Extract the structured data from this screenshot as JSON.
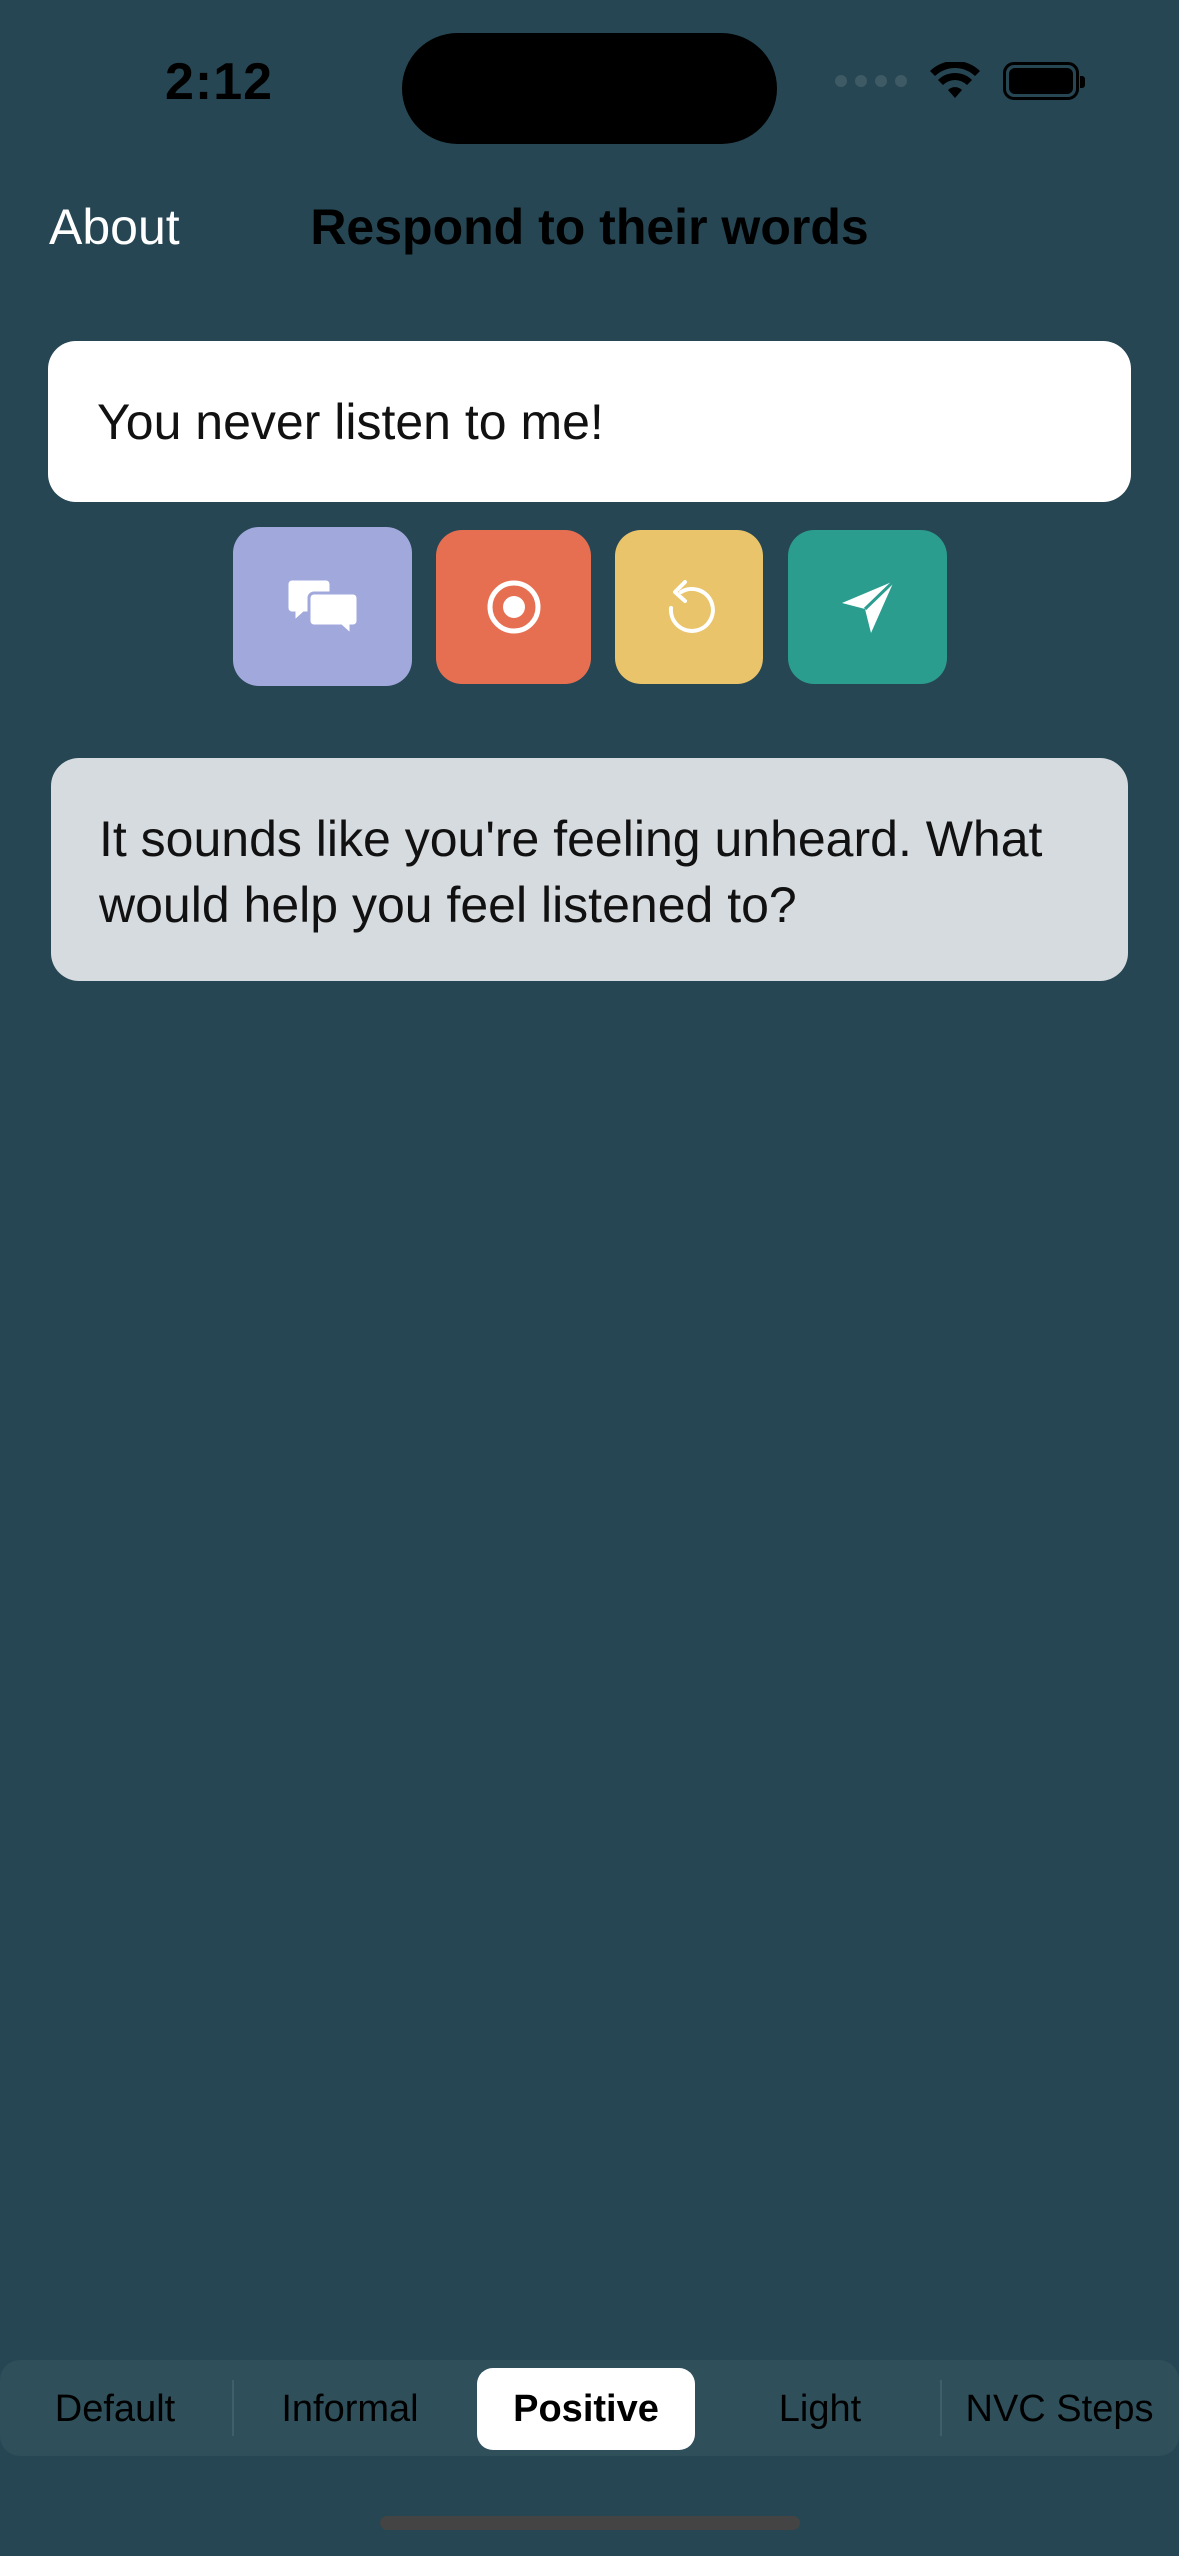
{
  "status_bar": {
    "time": "2:12"
  },
  "nav": {
    "about_label": "About",
    "title": "Respond to their words"
  },
  "input": {
    "value": "You never listen to me!"
  },
  "actions": [
    {
      "name": "conversation",
      "icon": "chat-bubbles-icon",
      "color": "#a0a8dc"
    },
    {
      "name": "record",
      "icon": "record-icon",
      "color": "#e76f51"
    },
    {
      "name": "reset",
      "icon": "reset-icon",
      "color": "#e9c46a"
    },
    {
      "name": "send",
      "icon": "send-icon",
      "color": "#2a9d8f"
    }
  ],
  "response": {
    "text": "It sounds like you're feeling unheard. What would help you feel listened to?"
  },
  "styles": {
    "items": [
      "Default",
      "Informal",
      "Positive",
      "Light",
      "NVC Steps"
    ],
    "selected": "Positive"
  },
  "colors": {
    "background": "#264653"
  }
}
